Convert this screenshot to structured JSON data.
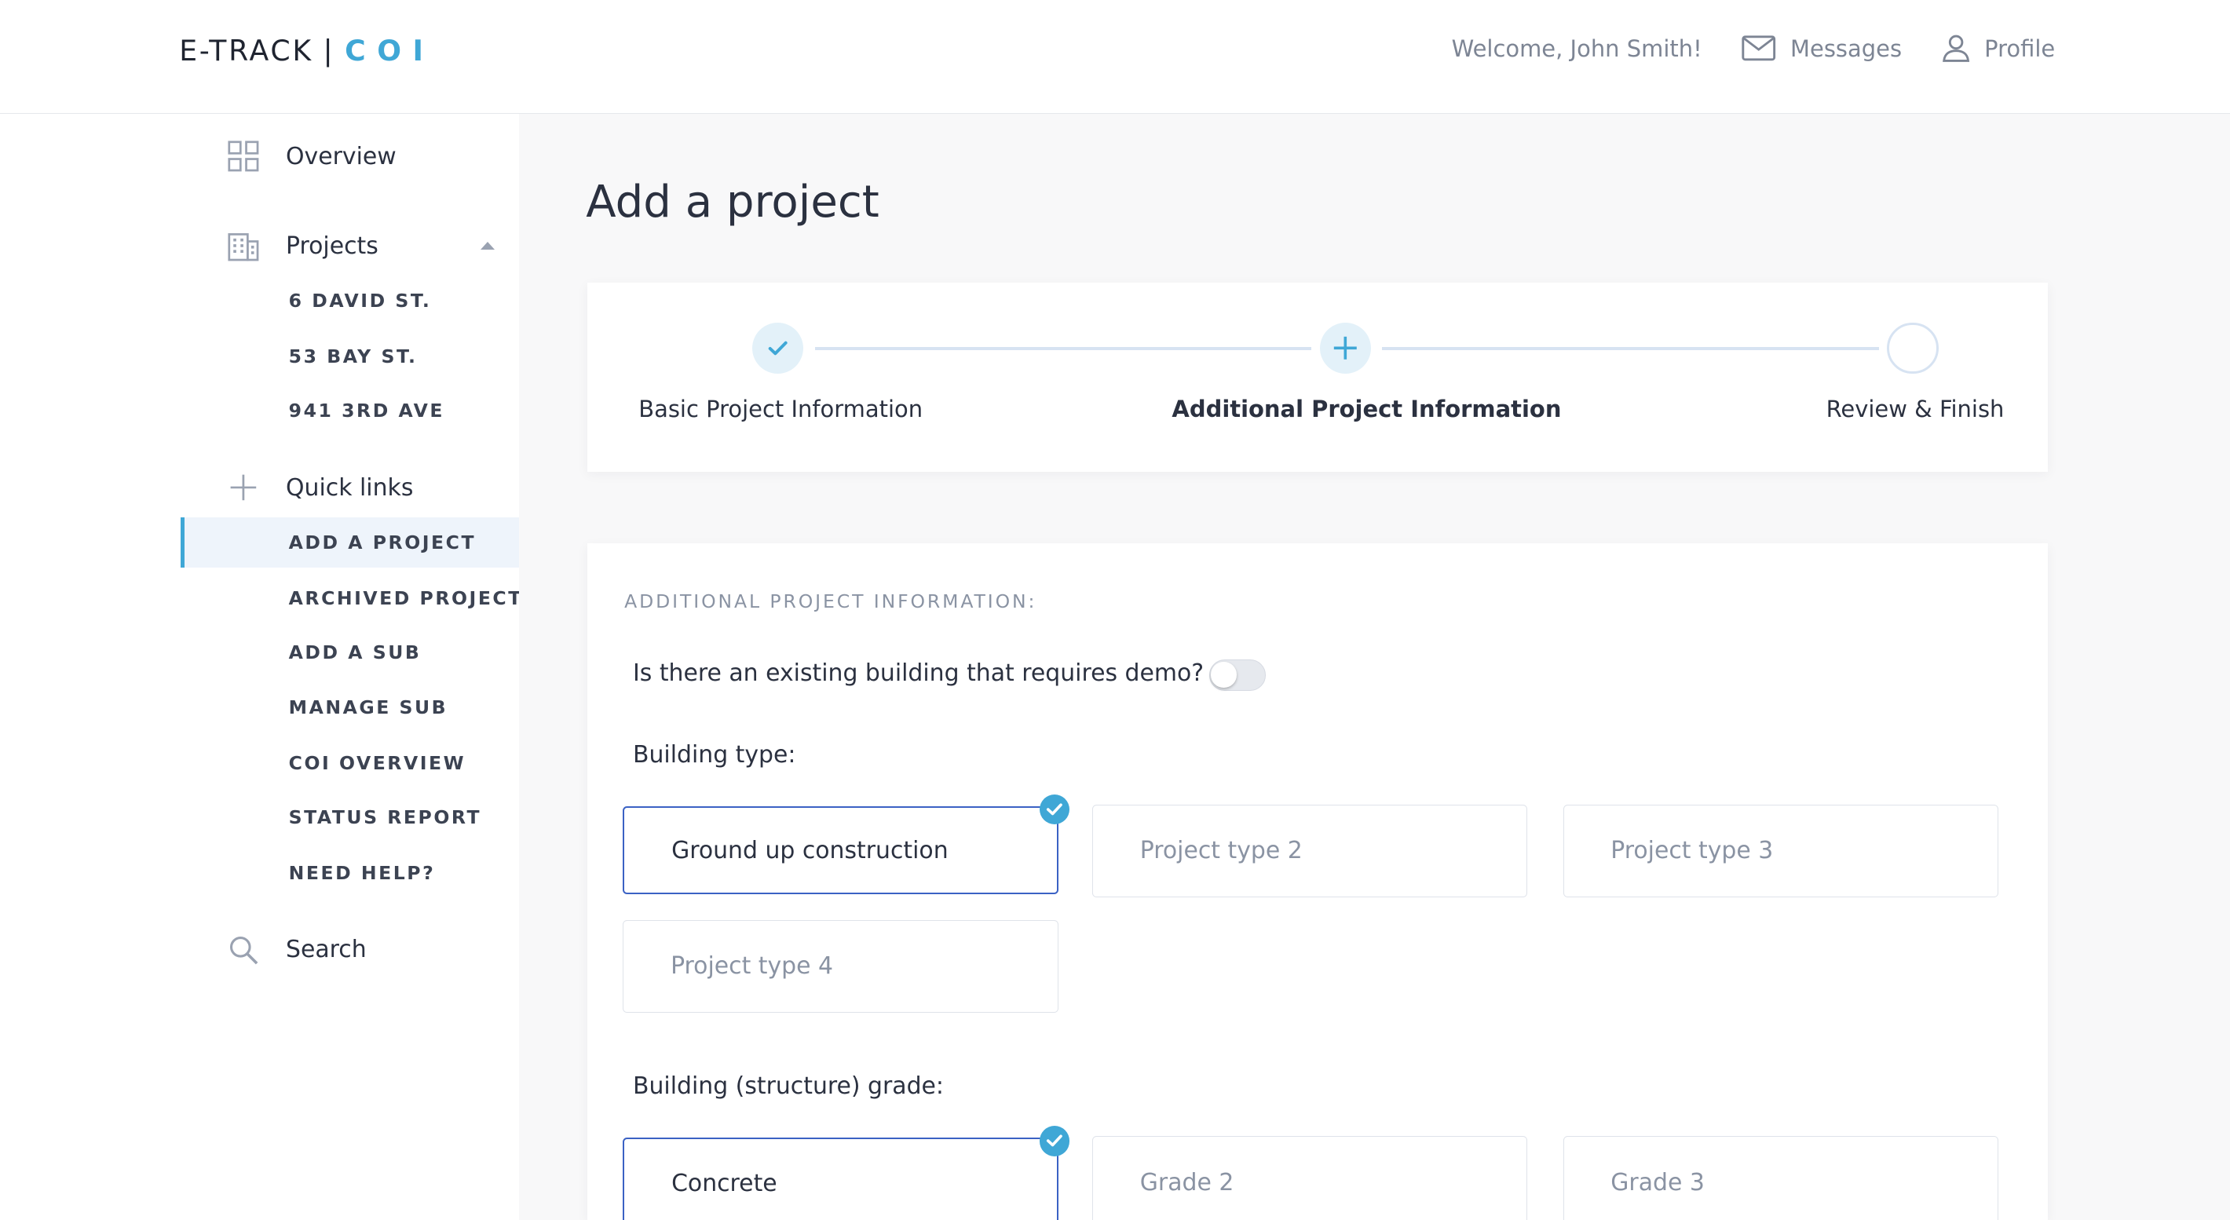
{
  "header": {
    "logo_main": "E-TRACK",
    "logo_sep": "|",
    "logo_accent": "COI",
    "welcome": "Welcome, John Smith!",
    "messages_label": "Messages",
    "profile_label": "Profile"
  },
  "sidebar": {
    "overview": "Overview",
    "projects": "Projects",
    "project_items": [
      "6 DAVID ST.",
      "53 BAY ST.",
      "941 3RD AVE"
    ],
    "quick_links": "Quick links",
    "quick_link_items": [
      "ADD A PROJECT",
      "ARCHIVED PROJECT",
      "ADD A SUB",
      "MANAGE SUB",
      "COI OVERVIEW",
      "STATUS REPORT",
      "NEED HELP?"
    ],
    "active_item": "ADD A PROJECT",
    "search": "Search"
  },
  "main": {
    "title": "Add a project",
    "steps": [
      {
        "label": "Basic Project Information",
        "state": "done"
      },
      {
        "label": "Additional Project Information",
        "state": "current"
      },
      {
        "label": "Review & Finish",
        "state": "pending"
      }
    ],
    "section_heading": "ADDITIONAL PROJECT INFORMATION:",
    "demo_question": "Is there an existing building that requires demo?",
    "demo_toggle_on": false,
    "building_type_label": "Building type:",
    "building_types": [
      "Ground up construction",
      "Project type 2",
      "Project type 3",
      "Project type 4"
    ],
    "building_type_selected": "Ground up construction",
    "grade_label": "Building (structure) grade:",
    "grades": [
      "Concrete",
      "Grade 2",
      "Grade 3"
    ],
    "grade_selected": "Concrete"
  },
  "colors": {
    "accent": "#3fa7d6",
    "selected_border": "#3b62c4",
    "active_nav_bg": "#eef4fb",
    "main_bg": "#f8f8f9",
    "step_line": "#d7e3f2"
  }
}
